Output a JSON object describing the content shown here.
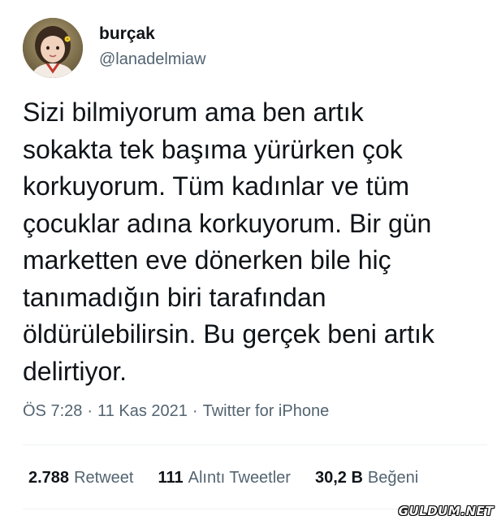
{
  "author": {
    "display_name": "burçak",
    "handle": "@lanadelmiaw",
    "avatar_icon": "child-photo-avatar"
  },
  "tweet": {
    "text": "Sizi bilmiyorum ama ben artık\nsokakta tek başıma yürürken çok\nkorkuyorum. Tüm kadınlar ve tüm\nçocuklar adına korkuyorum. Bir gün\nmarketten eve dönerken bile hiç\ntanımadığın biri tarafından\nöldürülebilirsin. Bu gerçek beni artık\ndelirtiyor."
  },
  "meta": {
    "time": "ÖS 7:28",
    "separator": "·",
    "date": "11 Kas 2021",
    "source": "Twitter for iPhone"
  },
  "stats": {
    "retweets_count": "2.788",
    "retweets_label": "Retweet",
    "quotes_count": "111",
    "quotes_label": "Alıntı Tweetler",
    "likes_count": "30,2 B",
    "likes_label": "Beğeni"
  },
  "watermark": "GULDUM.NET",
  "colors": {
    "text_primary": "#0f1419",
    "text_secondary": "#536471",
    "divider": "#eff3f4"
  }
}
